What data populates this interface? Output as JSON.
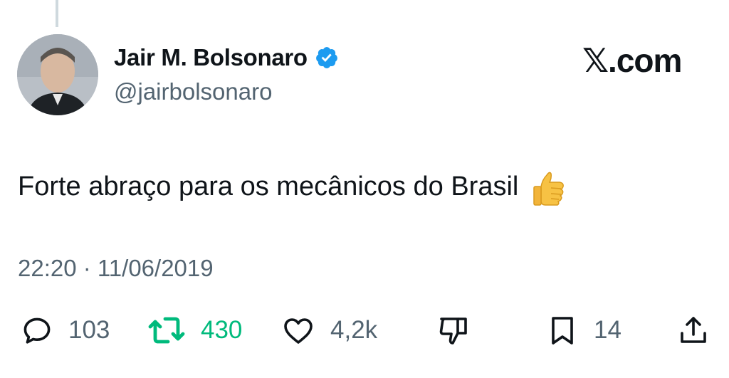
{
  "author": {
    "display_name": "Jair M. Bolsonaro",
    "handle": "@jairbolsonaro",
    "verified": true,
    "avatar_icon": "profile-photo"
  },
  "brand": {
    "label": "𝕏.com"
  },
  "tweet": {
    "text": "Forte abraço para os mecânicos do Brasil",
    "emoji_icon": "thumbs-up-emoji",
    "timestamp": "22:20 · 11/06/2019"
  },
  "actions": {
    "reply": {
      "icon": "reply-icon",
      "count": "103"
    },
    "retweet": {
      "icon": "retweet-icon",
      "count": "430",
      "color": "#00ba7c"
    },
    "like": {
      "icon": "heart-icon",
      "count": "4,2k"
    },
    "dislike": {
      "icon": "thumbs-down-icon"
    },
    "bookmark": {
      "icon": "bookmark-icon",
      "count": "14"
    },
    "share": {
      "icon": "share-icon"
    }
  },
  "colors": {
    "text": "#0f1419",
    "muted": "#536471",
    "verified": "#1d9bf0",
    "retweet": "#00ba7c"
  }
}
